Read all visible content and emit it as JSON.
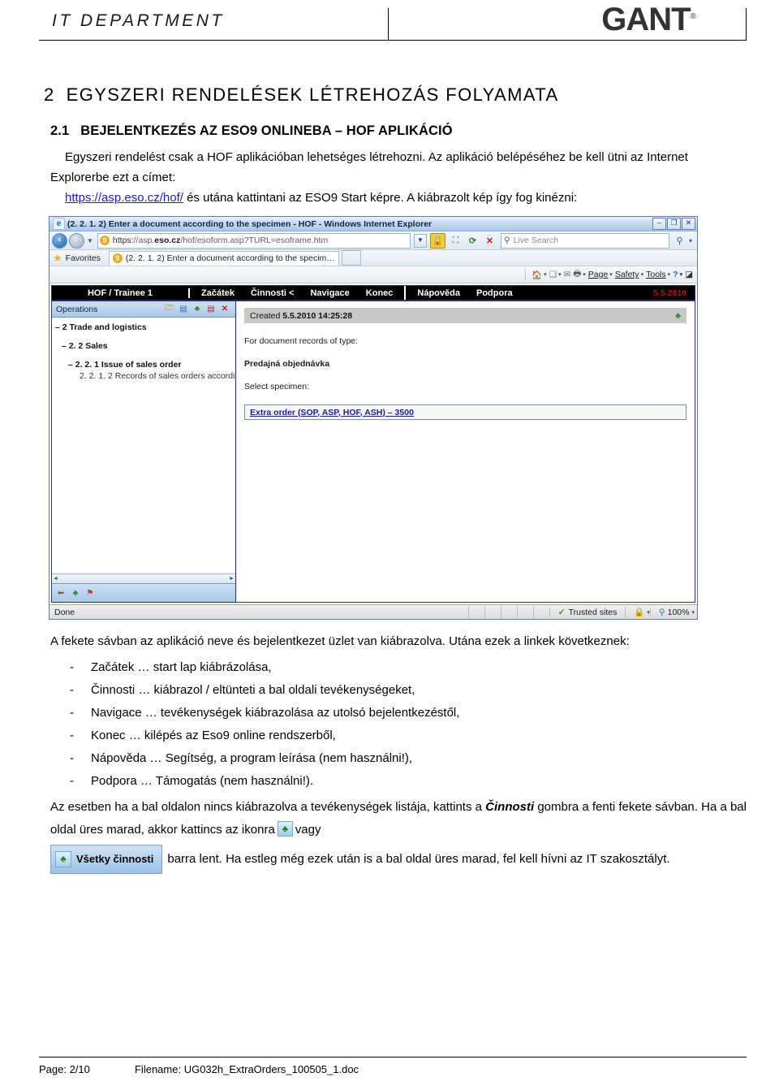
{
  "header": {
    "department": "IT DEPARTMENT",
    "brand": "GANT",
    "brand_mark": "®"
  },
  "document": {
    "chapter_number": "2",
    "chapter_title": "EGYSZERI RENDELÉSEK LÉTREHOZÁS FOLYAMATA",
    "section_number": "2.1",
    "section_title": "BEJELENTKEZÉS AZ ESO9 ONLINEBA – HOF APLIKÁCIÓ",
    "intro_paragraph": "Egyszeri rendelést csak a HOF aplikációban lehetséges létrehozni. Az aplikáció belépéséhez be kell ütni az Internet Explorerbe ezt a címet:",
    "link_text": "https://asp.eso.cz/hof/",
    "after_link_text": " és utána kattintani az ESO9 Start képre. A kiábrazolt kép így fog kinézni:",
    "link_color": "#1a1ae0"
  },
  "browser": {
    "titlebar": {
      "title": "(2. 2. 1. 2) Enter a document according to the specimen - HOF - Windows Internet Explorer",
      "favicon": "ie-icon",
      "minimize": "–",
      "maximize": "❐",
      "close": "✕"
    },
    "address": {
      "favicon": "eso9-favicon",
      "favicon_text": "9",
      "scheme": "https:",
      "host_prefix": "//asp.",
      "host_bold": "eso.cz",
      "path": "/hof/esoform.asp?TURL=esoframe.htm",
      "full_url": "https://asp.eso.cz/hof/esoform.asp?TURL=esoframe.htm",
      "back_label": "◄",
      "forward_label": "►",
      "dropdown_label": "▼"
    },
    "toolbar_icons": [
      "lock-icon",
      "compatibility-icon",
      "refresh-icon",
      "stop-icon"
    ],
    "search": {
      "placeholder": "Live Search",
      "icon": "magnifier-icon",
      "go_icon": "magnifier-icon",
      "dropdown": "▾"
    },
    "favorites_bar": {
      "star_icon": "star-icon",
      "label": "Favorites",
      "tab_title": "(2. 2. 1. 2) Enter a document according to the specim…"
    },
    "command_bar": {
      "icons": [
        "home-icon",
        "feeds-icon",
        "mail-icon",
        "print-icon"
      ],
      "items": [
        "Page",
        "Safety",
        "Tools"
      ],
      "help_icon": "help-icon",
      "last_icon": "minimize-ribbon-icon"
    },
    "app_menubar": {
      "app_name": "HOF / Trainee 1",
      "items": [
        "Začátek",
        "Činnosti <",
        "Navigace",
        "Konec"
      ],
      "help_items": [
        "Nápověda",
        "Podpora"
      ],
      "date": "5.5.2010",
      "date_color": "#cc0000"
    },
    "left_panel": {
      "header": "Operations",
      "toolbar_icons": [
        "open-folder-icon",
        "book-icon",
        "tree-icon",
        "document-help-icon",
        "close-red-x-icon"
      ],
      "tree": [
        "– 2 Trade and logistics",
        "– 2. 2 Sales",
        "– 2. 2. 1 Issue of sales order",
        "2. 2. 1. 2 Records of sales orders accordi"
      ],
      "bottom_icons": [
        "back-icon",
        "tree-green-icon",
        "flag-icon"
      ]
    },
    "right_panel": {
      "created_label": "Created",
      "created_value": "5.5.2010 14:25:28",
      "refresh_icon": "refresh-tree-icon",
      "type_label": "For document records of type:",
      "type_value": "Predajná objednávka",
      "select_label": "Select specimen:",
      "specimen_link": "Extra order (SOP, ASP, HOF, ASH) – 3500"
    },
    "statusbar": {
      "status": "Done",
      "zone_icon": "check-icon",
      "zone": "Trusted sites",
      "protected_icon": "lock-icon",
      "zoom_icon": "zoom-icon",
      "zoom": "100%",
      "zoom_caret": "▾"
    }
  },
  "after_image": {
    "lead_paragraph": "A fekete sávban az aplikáció neve és bejelentkezet üzlet van kiábrazolva. Utána ezek a linkek következnek:",
    "bullets": [
      {
        "dash": "-",
        "text": "Začátek … start lap kiábrázolása,"
      },
      {
        "dash": "-",
        "text": "Činnosti … kiábrazol / eltünteti a bal oldali tevékenységeket,"
      },
      {
        "dash": "-",
        "text": "Navigace … tevékenységek kiábrazolása az utolsó bejelentkezéstől,"
      },
      {
        "dash": "-",
        "text": "Konec … kilépés az Eso9 online rendszerből,"
      },
      {
        "dash": "-",
        "text": "Nápověda … Segítség, a program leírása (nem használni!),"
      },
      {
        "dash": "-",
        "text": "Podpora … Támogatás (nem használni!)."
      }
    ],
    "note_part1": "Az esetben ha a bal oldalon nincs kiábrazolva a tevékenységek listája, kattints a ",
    "note_bold": "Činnosti",
    "note_part2": " gombra a fenti fekete sávban. Ha a bal oldal üres marad, akkor kattincs az ikonra",
    "note_part3": "vagy",
    "button_label": "Všetky činnosti",
    "note_part4": "barra lent. Ha estleg még ezek után is a bal oldal üres marad, fel kell hívni az IT szakosztályt."
  },
  "footer": {
    "page_label": "Page: 2/10",
    "filename_label": "Filename: UG032h_ExtraOrders_100505_1.doc"
  }
}
